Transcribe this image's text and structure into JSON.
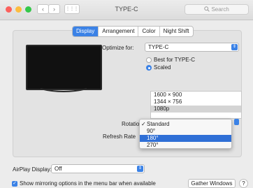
{
  "window": {
    "title": "TYPE-C",
    "back_glyph": "‹",
    "forward_glyph": "›",
    "grid_glyph": "⋮⋮⋮",
    "search_placeholder": "Search",
    "colors": {
      "close": "#fc605c",
      "minimize": "#fdbc40",
      "zoom": "#34c84a"
    }
  },
  "tabs": [
    {
      "label": "Display",
      "active": true
    },
    {
      "label": "Arrangement",
      "active": false
    },
    {
      "label": "Color",
      "active": false
    },
    {
      "label": "Night Shift",
      "active": false
    }
  ],
  "optimize": {
    "label": "Optimize for:",
    "value": "TYPE-C"
  },
  "resolution": {
    "option_best": "Best for TYPE-C",
    "option_scaled": "Scaled",
    "selected_option": "Scaled",
    "list": [
      "1600 × 900",
      "1344 × 756",
      "1080p"
    ],
    "selected_index": 2
  },
  "rotation": {
    "label": "Rotation",
    "options": [
      "Standard",
      "90°",
      "180°",
      "270°"
    ],
    "checked": "Standard",
    "highlighted": "180°"
  },
  "refresh": {
    "label": "Refresh Rate"
  },
  "airplay": {
    "label": "AirPlay Display:",
    "value": "Off"
  },
  "mirroring": {
    "label": "Show mirroring options in the menu bar when available",
    "checked": true
  },
  "buttons": {
    "gather": "Gather Windows",
    "help": "?"
  },
  "accent_color": "#3b82e6"
}
